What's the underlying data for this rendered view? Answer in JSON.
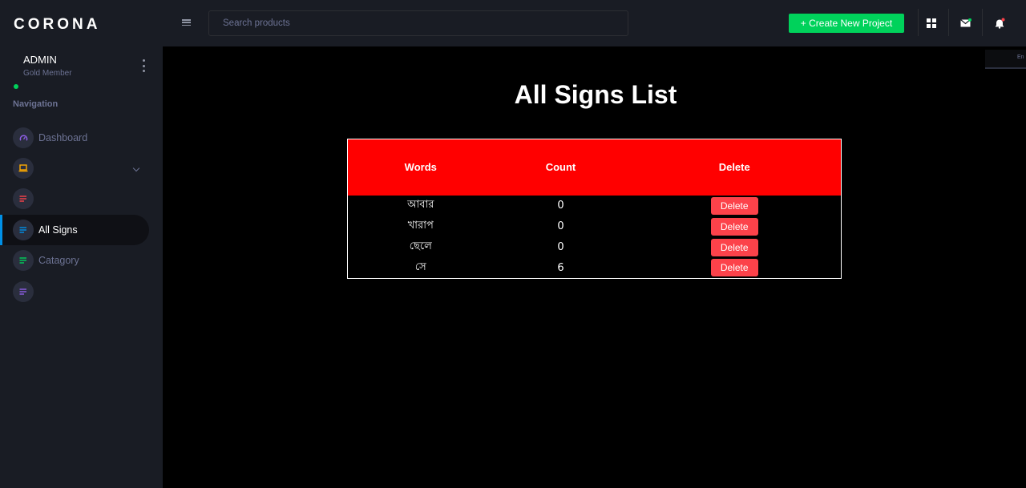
{
  "brand": "CORONA",
  "profile": {
    "name": "ADMIN",
    "role": "Gold Member"
  },
  "nav": {
    "heading": "Navigation",
    "items": [
      {
        "label": "Dashboard",
        "icon": "speedometer-icon",
        "color": "#8f5fe8"
      },
      {
        "label": "",
        "icon": "laptop-icon",
        "color": "#ffab00"
      },
      {
        "label": "",
        "icon": "list-icon",
        "color": "#fc424a"
      },
      {
        "label": "All Signs",
        "icon": "list-icon",
        "color": "#0090e7"
      },
      {
        "label": "Catagory",
        "icon": "list-icon",
        "color": "#00d25b"
      },
      {
        "label": "",
        "icon": "list-icon",
        "color": "#8f5fe8"
      }
    ]
  },
  "search": {
    "placeholder": "Search products"
  },
  "header": {
    "create_label": "+ Create New Project"
  },
  "page": {
    "title": "All Signs List"
  },
  "table": {
    "columns": [
      "Words",
      "Count",
      "Delete"
    ],
    "rows": [
      {
        "word": "আবার",
        "count": "0",
        "action": "Delete"
      },
      {
        "word": "খারাপ",
        "count": "0",
        "action": "Delete"
      },
      {
        "word": "ছেলে",
        "count": "0",
        "action": "Delete"
      },
      {
        "word": "সে",
        "count": "6",
        "action": "Delete"
      }
    ]
  },
  "colors": {
    "accent": "#0090e7",
    "success": "#00d25b",
    "danger": "#fc424a",
    "table_header": "#ff0000"
  }
}
